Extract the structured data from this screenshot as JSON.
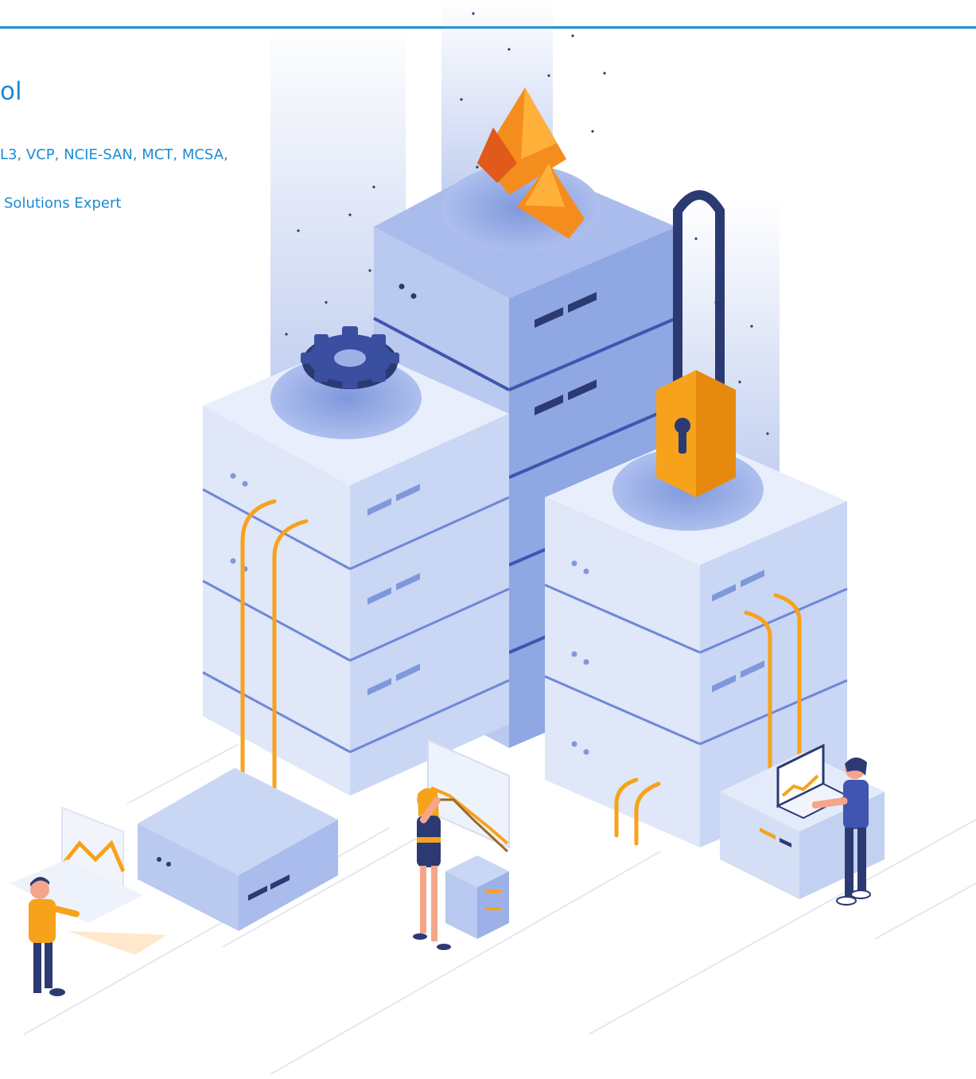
{
  "page": {
    "title": "ol",
    "credentials_line": "L3, VCP, NCIE-SAN, MCT, MCSA,",
    "role_line": "Solutions Expert"
  },
  "illustration": {
    "icons": [
      "fire-icon",
      "gear-icon",
      "padlock-icon",
      "analytics-screen-icon",
      "laptop-chart-icon"
    ],
    "colors": {
      "accent": "#1a8bd4",
      "server_light": "#dfe7f8",
      "server_mid": "#b9c9ef",
      "server_dark": "#8fa7e3",
      "orange": "#f7a21b",
      "navy": "#2c3a73"
    }
  }
}
